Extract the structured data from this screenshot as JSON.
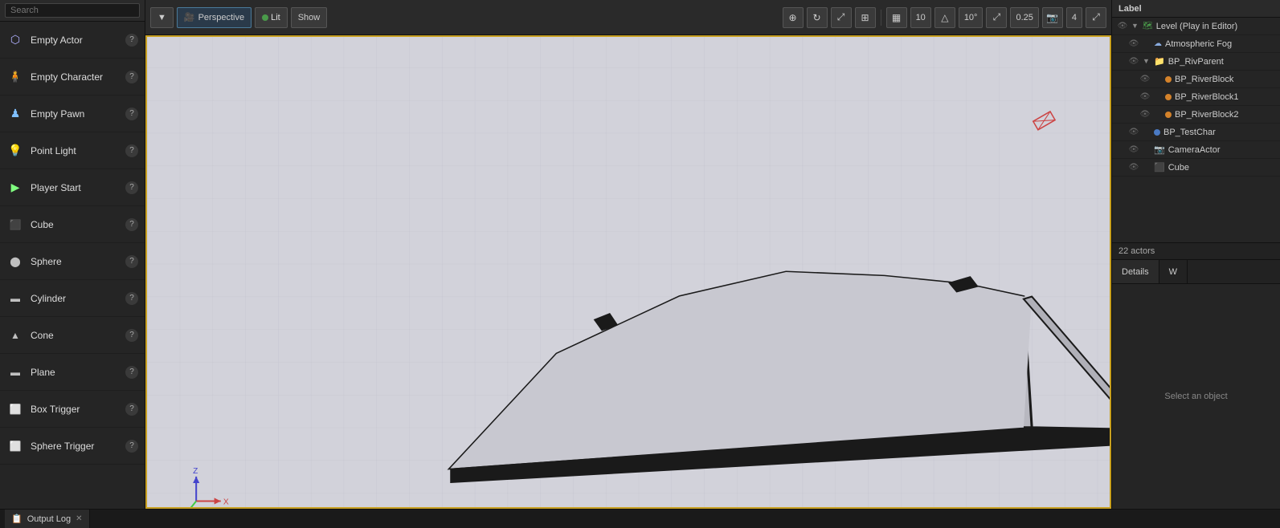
{
  "sidebar": {
    "search_placeholder": "Search",
    "items": [
      {
        "id": "empty-actor",
        "label": "Empty Actor",
        "icon": "actor"
      },
      {
        "id": "empty-character",
        "label": "Empty Character",
        "icon": "character"
      },
      {
        "id": "empty-pawn",
        "label": "Empty Pawn",
        "icon": "pawn"
      },
      {
        "id": "point-light",
        "label": "Point Light",
        "icon": "light"
      },
      {
        "id": "player-start",
        "label": "Player Start",
        "icon": "playerstart"
      },
      {
        "id": "cube",
        "label": "Cube",
        "icon": "cube"
      },
      {
        "id": "sphere",
        "label": "Sphere",
        "icon": "sphere"
      },
      {
        "id": "cylinder",
        "label": "Cylinder",
        "icon": "cylinder"
      },
      {
        "id": "cone",
        "label": "Cone",
        "icon": "cone"
      },
      {
        "id": "plane",
        "label": "Plane",
        "icon": "plane"
      },
      {
        "id": "box-trigger",
        "label": "Box Trigger",
        "icon": "trigger"
      },
      {
        "id": "sphere-trigger",
        "label": "Sphere Trigger",
        "icon": "trigger"
      }
    ]
  },
  "viewport": {
    "perspective_label": "Perspective",
    "lit_label": "Lit",
    "show_label": "Show",
    "grid_size": "10",
    "angle": "10°",
    "scale": "0.25",
    "camera_speed": "4"
  },
  "world_outliner": {
    "header_label": "Label",
    "actors_count": "22 actors",
    "items": [
      {
        "id": "level-play-in-editor",
        "label": "Level (Play in Editor)",
        "indent": 0,
        "icon": "level",
        "expanded": true
      },
      {
        "id": "atmospheric-fog",
        "label": "Atmospheric Fog",
        "indent": 1,
        "icon": "fog"
      },
      {
        "id": "bp-rivparent",
        "label": "BP_RivParent",
        "indent": 1,
        "icon": "folder",
        "expanded": true
      },
      {
        "id": "bp-riverblock",
        "label": "BP_RiverBlock",
        "indent": 2,
        "icon": "orange-dot"
      },
      {
        "id": "bp-riverblock1",
        "label": "BP_RiverBlock1",
        "indent": 2,
        "icon": "orange-dot"
      },
      {
        "id": "bp-riverblock2",
        "label": "BP_RiverBlock2",
        "indent": 2,
        "icon": "orange-dot"
      },
      {
        "id": "bp-testchar",
        "label": "BP_TestChar",
        "indent": 1,
        "icon": "blue-dot"
      },
      {
        "id": "camera-actor",
        "label": "CameraActor",
        "indent": 1,
        "icon": "camera"
      },
      {
        "id": "cube",
        "label": "Cube",
        "indent": 1,
        "icon": "cube"
      }
    ]
  },
  "details_panel": {
    "tab_details": "Details",
    "tab_world": "W",
    "empty_message": "Select an object"
  },
  "bottom_bar": {
    "output_log_label": "Output Log"
  }
}
